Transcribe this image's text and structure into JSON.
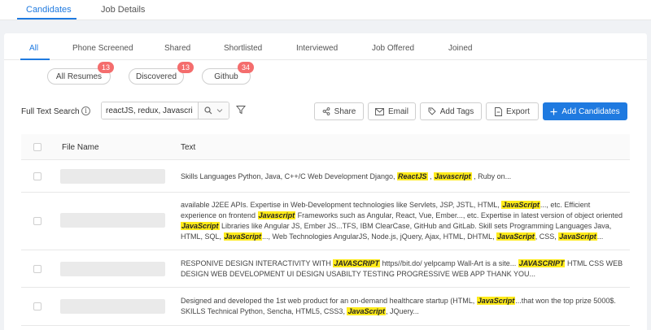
{
  "top_tabs": [
    {
      "label": "Candidates"
    },
    {
      "label": "Job Details"
    }
  ],
  "stage_tabs": [
    {
      "label": "All"
    },
    {
      "label": "Phone Screened"
    },
    {
      "label": "Shared"
    },
    {
      "label": "Shortlisted"
    },
    {
      "label": "Interviewed"
    },
    {
      "label": "Job Offered"
    },
    {
      "label": "Joined"
    }
  ],
  "sources": [
    {
      "label": "All Resumes",
      "count": "13"
    },
    {
      "label": "Discovered",
      "count": "13"
    },
    {
      "label": "Github",
      "count": "34"
    }
  ],
  "search": {
    "label": "Full Text Search",
    "info_glyph": "i",
    "value": "reactJS, redux, Javascri"
  },
  "actions": {
    "share": "Share",
    "email": "Email",
    "add_tags": "Add Tags",
    "export": "Export",
    "add_candidates": "Add Candidates"
  },
  "table": {
    "headers": {
      "file_name": "File Name",
      "text": "Text"
    },
    "rows": [
      {
        "segments": [
          {
            "t": "Skills Languages Python, Java, C++/C Web Development Django, "
          },
          {
            "t": "ReactJS",
            "hl": true
          },
          {
            "t": " , "
          },
          {
            "t": "Javascript",
            "hl": true
          },
          {
            "t": " , Ruby on..."
          }
        ]
      },
      {
        "segments": [
          {
            "t": "available J2EE APIs. Expertise in Web-Development technologies like Servlets, JSP, JSTL, HTML, "
          },
          {
            "t": "JavaScript",
            "hl": true
          },
          {
            "t": "..., etc. Efficient experience on frontend "
          },
          {
            "t": "Javascript",
            "hl": true
          },
          {
            "t": " Frameworks such as Angular, React, Vue, Ember..., etc. Expertise in latest version of object oriented "
          },
          {
            "t": "JavaScript",
            "hl": true
          },
          {
            "t": " Libraries like Angular JS, Ember JS...TFS, IBM ClearCase, GitHub and GitLab. Skill sets Programming Languages Java, HTML, SQL, "
          },
          {
            "t": "JavaScript",
            "hl": true
          },
          {
            "t": "..., Web Technologies AngularJS, Node.js, jQuery, Ajax, HTML, DHTML, "
          },
          {
            "t": "JavaScript",
            "hl": true
          },
          {
            "t": ", CSS, "
          },
          {
            "t": "JavaScript",
            "hl": true
          },
          {
            "t": "..."
          }
        ]
      },
      {
        "segments": [
          {
            "t": "RESPONIVE DESIGN INTERACTIVITY WITH "
          },
          {
            "t": "JAVASCRIPT",
            "hl": true
          },
          {
            "t": " https//bit.do/ yelpcamp Wall-Art is a site... "
          },
          {
            "t": "JAVASCRIPT",
            "hl": true
          },
          {
            "t": " HTML CSS WEB DESIGN WEB DEVELOPMENT UI DESIGN USABILTY TESTING PROGRESSIVE WEB APP THANK YOU..."
          }
        ]
      },
      {
        "segments": [
          {
            "t": "Designed and developed the 1st web product for an on-demand healthcare startup (HTML, "
          },
          {
            "t": "JavaScript",
            "hl": true
          },
          {
            "t": "...that won the top prize 5000$. SKILLS Technical Python, Sencha, HTML5, CSS3, "
          },
          {
            "t": "JavaScript",
            "hl": true
          },
          {
            "t": ", JQuery..."
          }
        ]
      }
    ]
  },
  "colors": {
    "accent": "#1f7ae0",
    "badge": "#f46d6d",
    "highlight": "#ffeb1a"
  }
}
